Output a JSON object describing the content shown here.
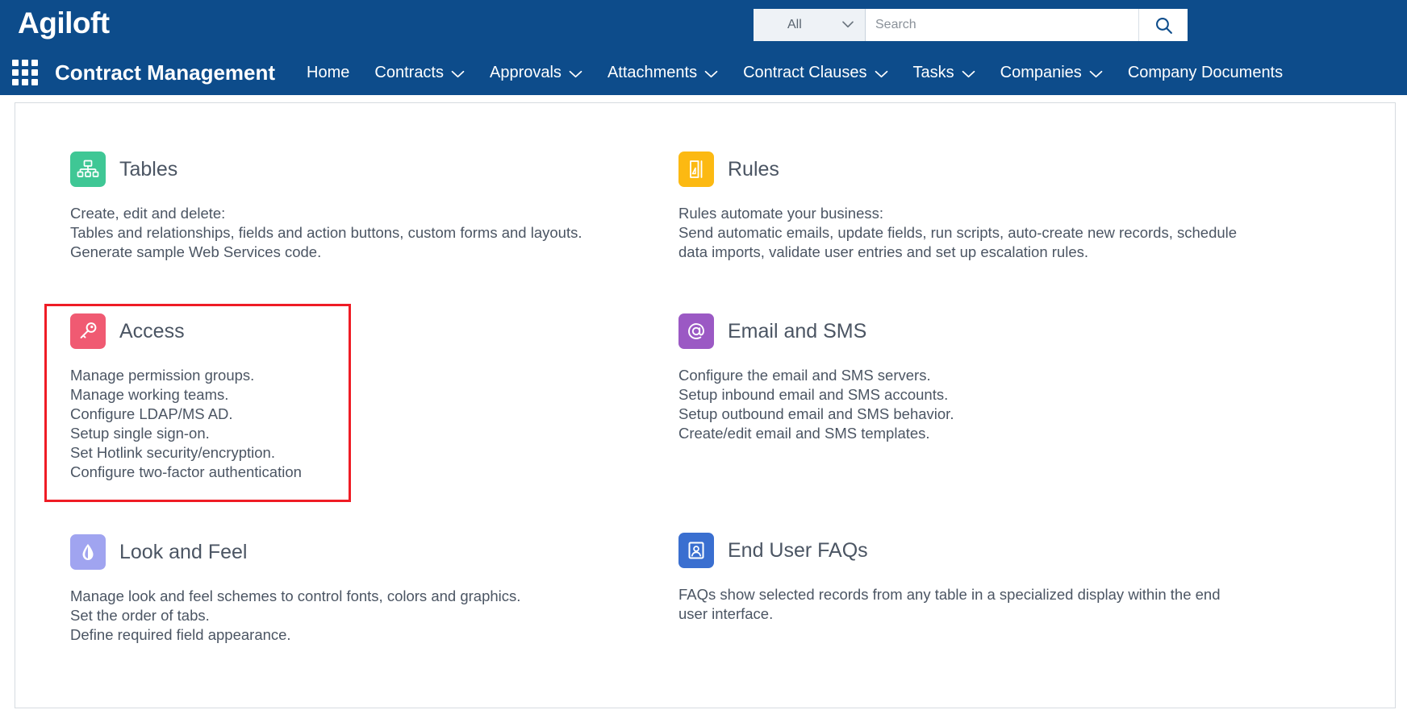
{
  "header": {
    "brand": "Agiloft",
    "search": {
      "scope_selected": "All",
      "scope_options": [
        "All"
      ],
      "placeholder": "Search",
      "value": "",
      "button_icon": "search-icon"
    }
  },
  "nav": {
    "apps_icon": "apps-grid-icon",
    "app_title": "Contract Management",
    "items": [
      {
        "label": "Home",
        "has_menu": false
      },
      {
        "label": "Contracts",
        "has_menu": true
      },
      {
        "label": "Approvals",
        "has_menu": true
      },
      {
        "label": "Attachments",
        "has_menu": true
      },
      {
        "label": "Contract Clauses",
        "has_menu": true
      },
      {
        "label": "Tasks",
        "has_menu": true
      },
      {
        "label": "Companies",
        "has_menu": true
      },
      {
        "label": "Company Documents",
        "has_menu": false
      }
    ],
    "chevron_glyph": "⌄"
  },
  "colors": {
    "header_blue": "#0d4c8b",
    "tables_icon": "#3fc795",
    "rules_icon": "#fcb912",
    "access_icon": "#f05a72",
    "email_icon": "#9b59c4",
    "look_feel_icon": "#a0a4f0",
    "faq_icon": "#3a6fd0",
    "highlight_border": "#ef1c25",
    "body_text": "#4b5563"
  },
  "cards": [
    {
      "id": "tables",
      "title": "Tables",
      "icon": "hierarchy-icon",
      "icon_color": "#3fc795",
      "lines": [
        "Create, edit and delete:",
        "Tables and relationships, fields and action buttons, custom forms and layouts.",
        "Generate sample Web Services code."
      ]
    },
    {
      "id": "rules",
      "title": "Rules",
      "icon": "rules-document-icon",
      "icon_color": "#fcb912",
      "lines": [
        "Rules automate your business:",
        "Send automatic emails, update fields, run scripts, auto-create new records, schedule",
        "data imports, validate user entries and set up escalation rules."
      ]
    },
    {
      "id": "access",
      "title": "Access",
      "icon": "key-icon",
      "icon_color": "#f05a72",
      "highlighted": true,
      "lines": [
        "Manage permission groups.",
        "Manage working teams.",
        "Configure LDAP/MS AD.",
        "Setup single sign-on.",
        "Set Hotlink security/encryption.",
        "Configure two-factor authentication"
      ]
    },
    {
      "id": "email-and-sms",
      "title": "Email and SMS",
      "icon": "at-sign-icon",
      "icon_color": "#9b59c4",
      "lines": [
        "Configure the email and SMS servers.",
        "Setup inbound email and SMS accounts.",
        "Setup outbound email and SMS behavior.",
        "Create/edit email and SMS templates."
      ]
    },
    {
      "id": "look-and-feel",
      "title": "Look and Feel",
      "icon": "droplet-icon",
      "icon_color": "#a0a4f0",
      "lines": [
        "Manage look and feel schemes to control fonts, colors and graphics.",
        "Set the order of tabs.",
        "Define required field appearance."
      ]
    },
    {
      "id": "end-user-faqs",
      "title": "End User FAQs",
      "icon": "id-badge-icon",
      "icon_color": "#3a6fd0",
      "lines": [
        "FAQs show selected records from any table in a specialized display within the end",
        "user interface."
      ]
    }
  ]
}
